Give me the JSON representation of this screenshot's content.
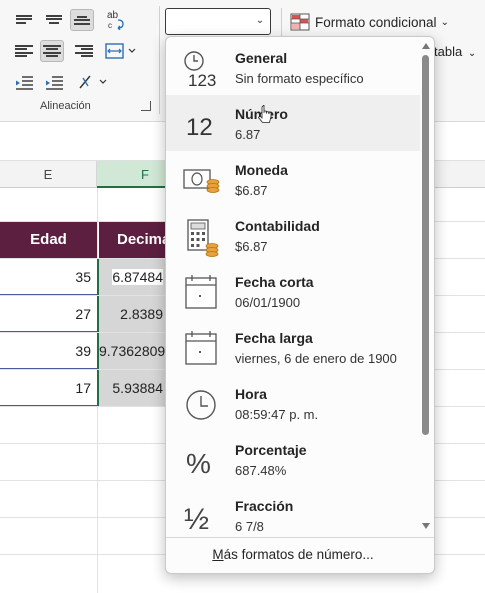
{
  "ribbon": {
    "alignment_group_label": "Alineación",
    "wrap_icon_text": "ab",
    "conditional_format_label": "Formato condicional",
    "table_format_label": "tabla",
    "number_format_value": ""
  },
  "sheet": {
    "columns": [
      {
        "letter": "E"
      },
      {
        "letter": "F"
      }
    ],
    "header_cells": [
      "Edad",
      "Decima"
    ],
    "rows": [
      {
        "age": "35",
        "decimal": "6.87484"
      },
      {
        "age": "27",
        "decimal": "2.8389"
      },
      {
        "age": "39",
        "decimal": "9.7362809"
      },
      {
        "age": "17",
        "decimal": "5.93884"
      }
    ],
    "header_color": "#5c1f3f"
  },
  "dropdown": {
    "items": [
      {
        "title": "General",
        "subtitle": "Sin formato específico",
        "icon": "general-clock-123-icon",
        "icon_text": "123"
      },
      {
        "title": "Número",
        "subtitle": "6.87",
        "icon": "number-12-icon",
        "icon_text": "12"
      },
      {
        "title": "Moneda",
        "subtitle": "$6.87",
        "icon": "currency-bill-coins-icon"
      },
      {
        "title": "Contabilidad",
        "subtitle": " $6.87",
        "icon": "accounting-calculator-icon"
      },
      {
        "title": "Fecha corta",
        "subtitle": "06/01/1900",
        "icon": "calendar-icon"
      },
      {
        "title": "Fecha larga",
        "subtitle": "viernes, 6 de enero de 1900",
        "icon": "calendar-icon"
      },
      {
        "title": "Hora",
        "subtitle": "08:59:47 p. m.",
        "icon": "clock-icon"
      },
      {
        "title": "Porcentaje",
        "subtitle": "687.48%",
        "icon": "percent-icon",
        "icon_text": "%"
      },
      {
        "title": "Fracción",
        "subtitle": "6 7/8",
        "icon": "fraction-icon",
        "icon_text": "½"
      }
    ],
    "hovered_item": "Número",
    "more_formats_accel": "M",
    "more_formats_rest": "ás formatos de número..."
  }
}
